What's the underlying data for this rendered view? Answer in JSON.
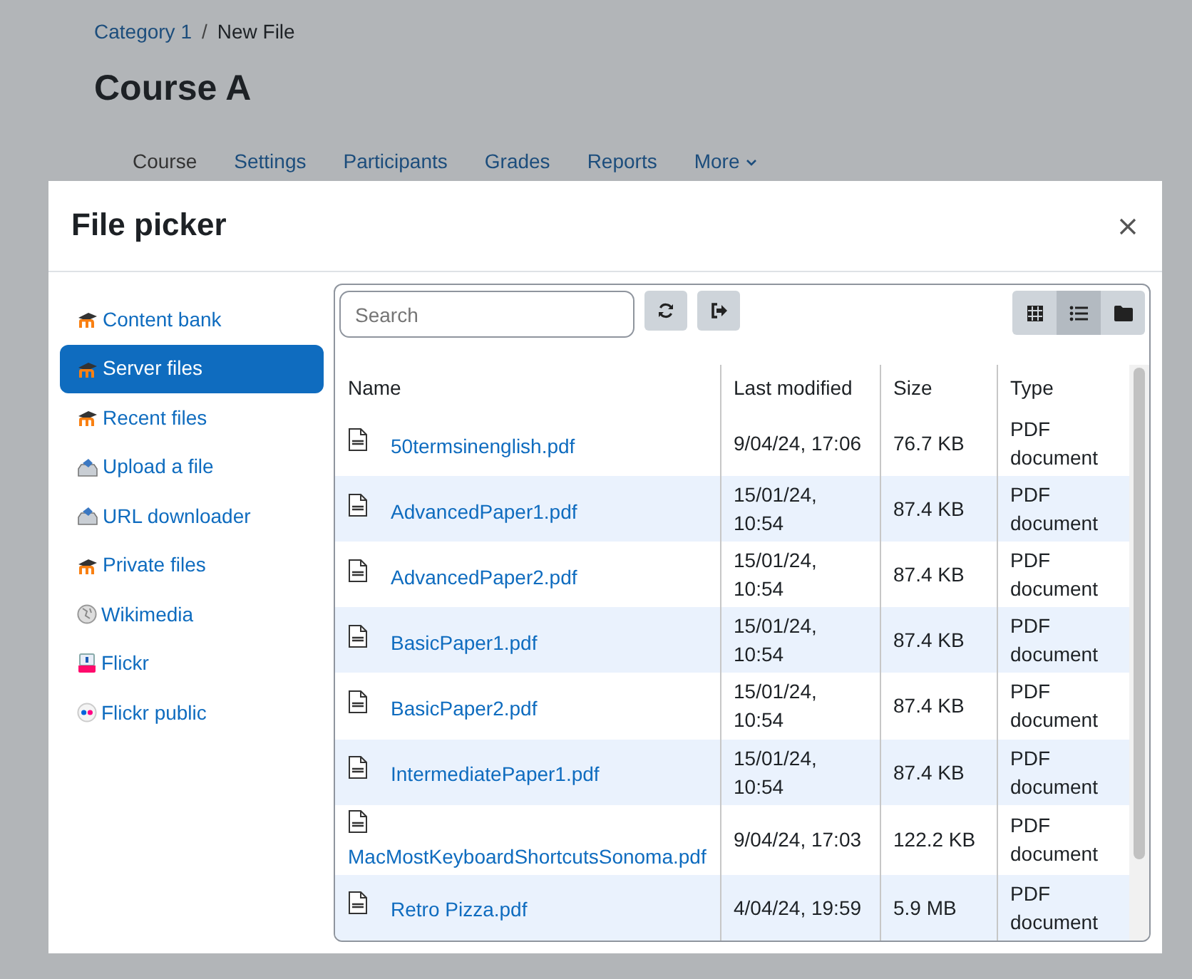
{
  "breadcrumb": [
    {
      "label": "Category 1",
      "link": true
    },
    {
      "label": "New File",
      "link": false
    }
  ],
  "breadcrumb_separator": "/",
  "page_title": "Course A",
  "course_nav": [
    {
      "label": "Course",
      "selected": true,
      "has_menu": false
    },
    {
      "label": "Settings",
      "selected": false,
      "has_menu": false
    },
    {
      "label": "Participants",
      "selected": false,
      "has_menu": false
    },
    {
      "label": "Grades",
      "selected": false,
      "has_menu": false
    },
    {
      "label": "Reports",
      "selected": false,
      "has_menu": false
    },
    {
      "label": "More",
      "selected": false,
      "has_menu": true
    }
  ],
  "dialog": {
    "title": "File picker",
    "repositories": [
      {
        "label": "Content bank",
        "kind": "moodle",
        "selected": false
      },
      {
        "label": "Server files",
        "kind": "moodle",
        "selected": true
      },
      {
        "label": "Recent files",
        "kind": "moodle",
        "selected": false
      },
      {
        "label": "Upload a file",
        "kind": "upload",
        "selected": false
      },
      {
        "label": "URL downloader",
        "kind": "upload",
        "selected": false
      },
      {
        "label": "Private files",
        "kind": "moodle",
        "selected": false
      },
      {
        "label": "Wikimedia",
        "kind": "wikimedia",
        "selected": false
      },
      {
        "label": "Flickr",
        "kind": "flickr",
        "selected": false
      },
      {
        "label": "Flickr public",
        "kind": "flickr_public",
        "selected": false
      }
    ],
    "search": {
      "placeholder": "Search"
    },
    "view_modes": [
      {
        "kind": "grid",
        "selected": false
      },
      {
        "kind": "list",
        "selected": true
      },
      {
        "kind": "tree",
        "selected": false
      }
    ],
    "table": {
      "columns": [
        "Name",
        "Last modified",
        "Size",
        "Type"
      ],
      "rows": [
        {
          "name": "50termsinenglish.pdf",
          "modified": "9/04/24, 17:06",
          "size": "76.7 KB",
          "type": "PDF document"
        },
        {
          "name": "AdvancedPaper1.pdf",
          "modified": "15/01/24, 10:54",
          "size": "87.4 KB",
          "type": "PDF document"
        },
        {
          "name": "AdvancedPaper2.pdf",
          "modified": "15/01/24, 10:54",
          "size": "87.4 KB",
          "type": "PDF document"
        },
        {
          "name": "BasicPaper1.pdf",
          "modified": "15/01/24, 10:54",
          "size": "87.4 KB",
          "type": "PDF document"
        },
        {
          "name": "BasicPaper2.pdf",
          "modified": "15/01/24, 10:54",
          "size": "87.4 KB",
          "type": "PDF document"
        },
        {
          "name": "IntermediatePaper1.pdf",
          "modified": "15/01/24, 10:54",
          "size": "87.4 KB",
          "type": "PDF document"
        },
        {
          "name": "MacMostKeyboardShortcutsSonoma.pdf",
          "modified": "9/04/24, 17:03",
          "size": "122.2 KB",
          "type": "PDF document"
        },
        {
          "name": "Retro Pizza.pdf",
          "modified": "4/04/24, 19:59",
          "size": "5.9 MB",
          "type": "PDF document"
        }
      ]
    }
  }
}
